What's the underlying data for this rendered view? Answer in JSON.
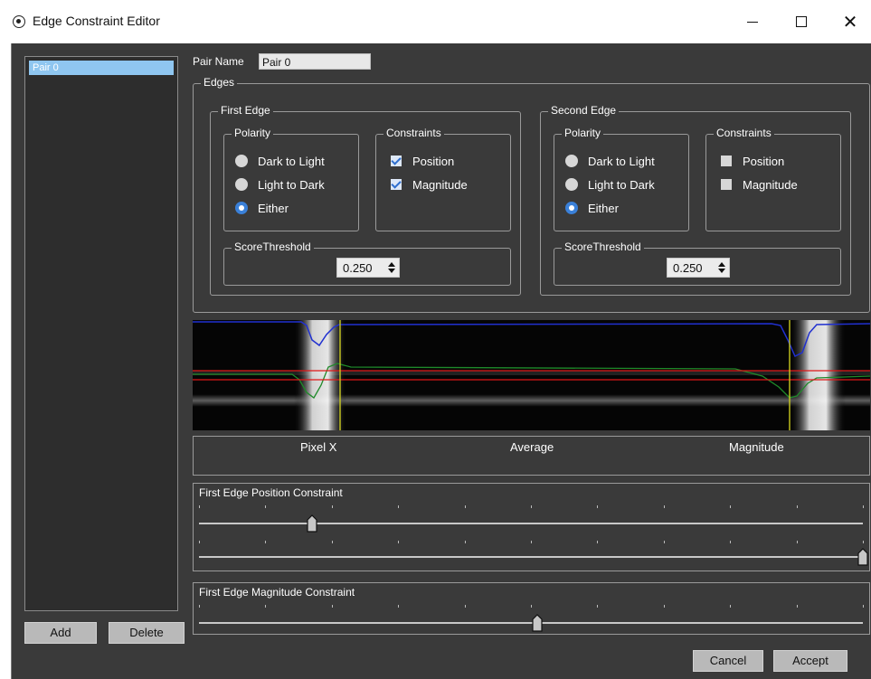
{
  "window": {
    "title": "Edge Constraint Editor",
    "minimize": "—",
    "maximize": "☐",
    "close": "✕"
  },
  "pairs": {
    "items": [
      "Pair 0"
    ],
    "add_label": "Add",
    "delete_label": "Delete"
  },
  "pair_name": {
    "label": "Pair Name",
    "value": "Pair 0"
  },
  "edges": {
    "label": "Edges",
    "first": {
      "label": "First Edge",
      "polarity": {
        "label": "Polarity",
        "options": [
          "Dark to Light",
          "Light to Dark",
          "Either"
        ],
        "selected": "Either"
      },
      "constraints": {
        "label": "Constraints",
        "position_label": "Position",
        "position_checked": true,
        "magnitude_label": "Magnitude",
        "magnitude_checked": true
      },
      "score": {
        "label": "ScoreThreshold",
        "value": "0.250"
      }
    },
    "second": {
      "label": "Second Edge",
      "polarity": {
        "label": "Polarity",
        "options": [
          "Dark to Light",
          "Light to Dark",
          "Either"
        ],
        "selected": "Either"
      },
      "constraints": {
        "label": "Constraints",
        "position_label": "Position",
        "position_checked": false,
        "magnitude_label": "Magnitude",
        "magnitude_checked": false
      },
      "score": {
        "label": "ScoreThreshold",
        "value": "0.250"
      }
    }
  },
  "profile_labels": {
    "pixel_x": "Pixel X",
    "average": "Average",
    "magnitude": "Magnitude"
  },
  "position_constraint": {
    "label": "First Edge Position Constraint",
    "lower": 0.17,
    "upper": 1.0
  },
  "magnitude_constraint": {
    "label": "First Edge Magnitude Constraint",
    "value": 0.51
  },
  "footer": {
    "cancel_label": "Cancel",
    "accept_label": "Accept"
  },
  "colors": {
    "accent": "#3a80d8",
    "selection": "#8fc6f0",
    "background": "#3a3a3a",
    "profile_blue": "#2030d0",
    "profile_green": "#1f8a2a",
    "profile_red": "#e01818",
    "edge_marker": "#d8d820"
  }
}
